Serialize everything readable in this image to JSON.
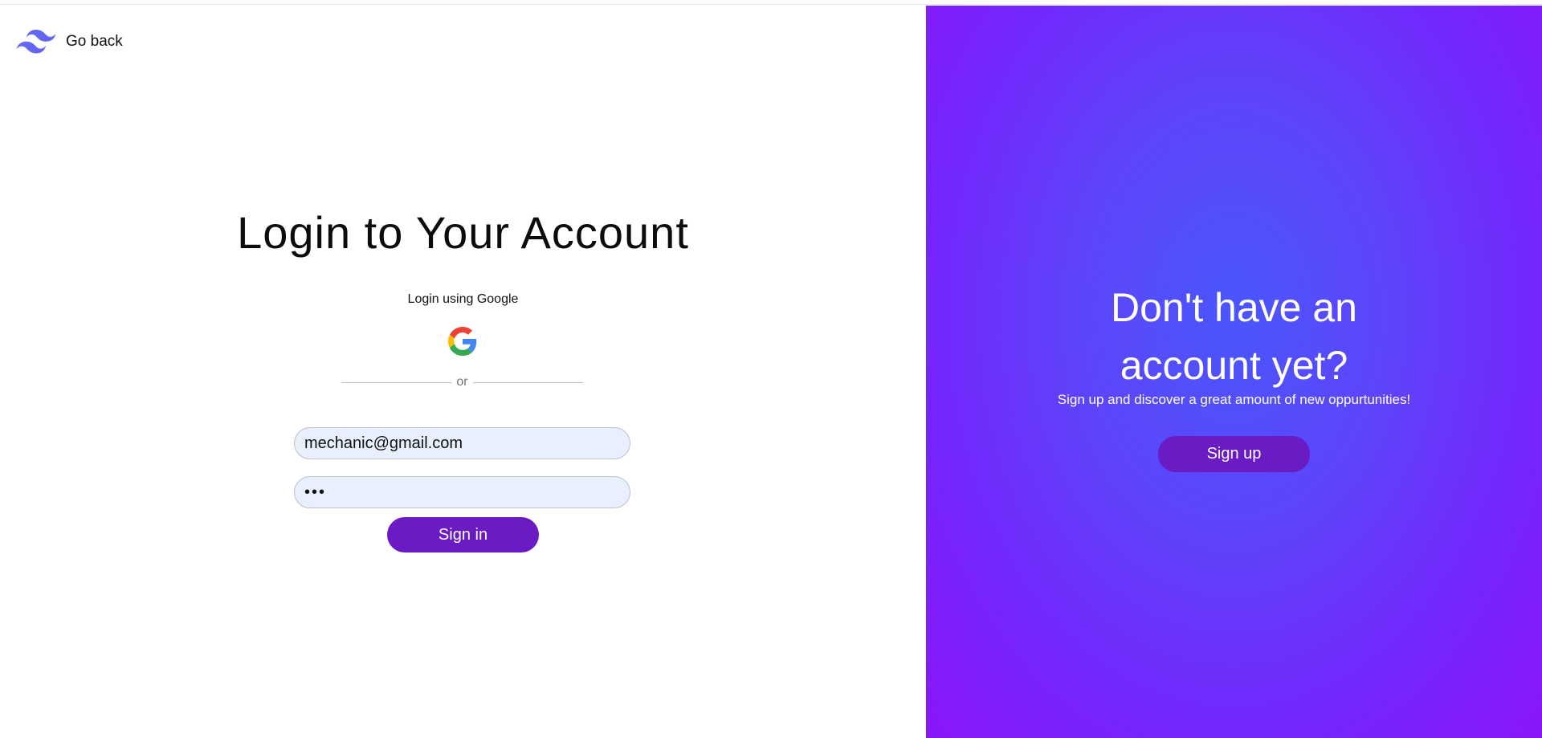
{
  "nav": {
    "go_back_label": "Go back",
    "logo_icon": "tailwind-wave-icon"
  },
  "login": {
    "title": "Login to Your Account",
    "google_label": "Login using Google",
    "google_icon": "google-icon",
    "divider_text": "or",
    "email_value": "mechanic@gmail.com",
    "password_value": "•••",
    "signin_label": "Sign in"
  },
  "signup_panel": {
    "heading_line1": "Don't have an",
    "heading_line2": "account yet?",
    "subtitle": "Sign up and discover a great amount of new oppurtunities!",
    "signup_label": "Sign up"
  },
  "colors": {
    "button": "#6a1bc4",
    "panel_center": "#4a56fb",
    "panel_edge": "#8b16f8",
    "input_bg": "#e8f0fe",
    "logo": "#6366f1"
  }
}
